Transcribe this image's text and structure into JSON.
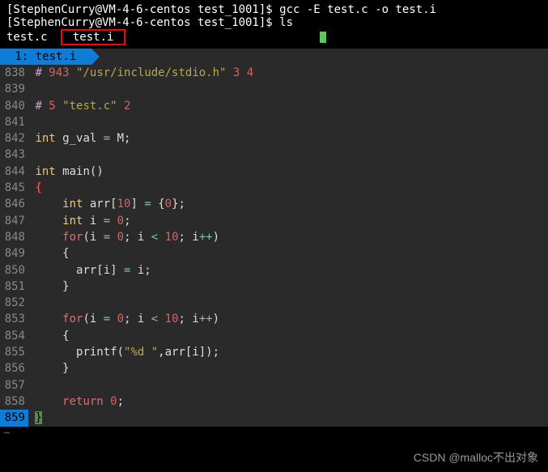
{
  "terminal": {
    "prompt1_full": "[StephenCurry@VM-4-6-centos test_1001]$ ",
    "cmd1": "gcc -E test.c -o test.i",
    "prompt2_full": "[StephenCurry@VM-4-6-centos test_1001]$ ",
    "cmd2": "ls",
    "ls_file1": "test.c  ",
    "ls_file2": " test.i "
  },
  "tab": {
    "label": " 1: test.i "
  },
  "code": {
    "lines": [
      {
        "num": "838",
        "tokens": [
          {
            "t": "# ",
            "c": "c-hash"
          },
          {
            "t": "943",
            "c": "c-number"
          },
          {
            "t": " ",
            "c": ""
          },
          {
            "t": "\"/usr/include/stdio.h\"",
            "c": "c-string"
          },
          {
            "t": " ",
            "c": ""
          },
          {
            "t": "3 4",
            "c": "c-number"
          }
        ]
      },
      {
        "num": "839",
        "tokens": []
      },
      {
        "num": "840",
        "tokens": [
          {
            "t": "# ",
            "c": "c-hash"
          },
          {
            "t": "5",
            "c": "c-number"
          },
          {
            "t": " ",
            "c": ""
          },
          {
            "t": "\"test.c\"",
            "c": "c-string"
          },
          {
            "t": " ",
            "c": ""
          },
          {
            "t": "2",
            "c": "c-number"
          }
        ]
      },
      {
        "num": "841",
        "tokens": []
      },
      {
        "num": "842",
        "tokens": [
          {
            "t": "int",
            "c": "c-type"
          },
          {
            "t": " g_val ",
            "c": "c-ident"
          },
          {
            "t": "=",
            "c": "c-op"
          },
          {
            "t": " M;",
            "c": "c-ident"
          }
        ]
      },
      {
        "num": "843",
        "tokens": []
      },
      {
        "num": "844",
        "tokens": [
          {
            "t": "int",
            "c": "c-type"
          },
          {
            "t": " ",
            "c": ""
          },
          {
            "t": "main",
            "c": "c-func"
          },
          {
            "t": "()",
            "c": "c-punct"
          }
        ]
      },
      {
        "num": "845",
        "tokens": [
          {
            "t": "{",
            "c": "c-brace-red"
          }
        ]
      },
      {
        "num": "846",
        "tokens": [
          {
            "t": "    ",
            "c": ""
          },
          {
            "t": "int",
            "c": "c-type"
          },
          {
            "t": " arr[",
            "c": "c-ident"
          },
          {
            "t": "10",
            "c": "c-number"
          },
          {
            "t": "] ",
            "c": "c-ident"
          },
          {
            "t": "=",
            "c": "c-op"
          },
          {
            "t": " {",
            "c": "c-punct"
          },
          {
            "t": "0",
            "c": "c-number"
          },
          {
            "t": "};",
            "c": "c-punct"
          }
        ]
      },
      {
        "num": "847",
        "tokens": [
          {
            "t": "    ",
            "c": ""
          },
          {
            "t": "int",
            "c": "c-type"
          },
          {
            "t": " i ",
            "c": "c-ident"
          },
          {
            "t": "=",
            "c": "c-op"
          },
          {
            "t": " ",
            "c": ""
          },
          {
            "t": "0",
            "c": "c-number"
          },
          {
            "t": ";",
            "c": "c-punct"
          }
        ]
      },
      {
        "num": "848",
        "tokens": [
          {
            "t": "    ",
            "c": ""
          },
          {
            "t": "for",
            "c": "c-keyword"
          },
          {
            "t": "(i ",
            "c": "c-ident"
          },
          {
            "t": "=",
            "c": "c-op"
          },
          {
            "t": " ",
            "c": ""
          },
          {
            "t": "0",
            "c": "c-number"
          },
          {
            "t": "; i ",
            "c": "c-ident"
          },
          {
            "t": "<",
            "c": "c-op"
          },
          {
            "t": " ",
            "c": ""
          },
          {
            "t": "10",
            "c": "c-number"
          },
          {
            "t": "; i",
            "c": "c-ident"
          },
          {
            "t": "++",
            "c": "c-op"
          },
          {
            "t": ")",
            "c": "c-punct"
          }
        ]
      },
      {
        "num": "849",
        "tokens": [
          {
            "t": "    {",
            "c": "c-punct"
          }
        ]
      },
      {
        "num": "850",
        "tokens": [
          {
            "t": "      arr[i] ",
            "c": "c-ident"
          },
          {
            "t": "=",
            "c": "c-op"
          },
          {
            "t": " i;",
            "c": "c-ident"
          }
        ]
      },
      {
        "num": "851",
        "tokens": [
          {
            "t": "    }",
            "c": "c-punct"
          }
        ]
      },
      {
        "num": "852",
        "tokens": []
      },
      {
        "num": "853",
        "tokens": [
          {
            "t": "    ",
            "c": ""
          },
          {
            "t": "for",
            "c": "c-keyword"
          },
          {
            "t": "(i ",
            "c": "c-ident"
          },
          {
            "t": "=",
            "c": "c-op"
          },
          {
            "t": " ",
            "c": ""
          },
          {
            "t": "0",
            "c": "c-number"
          },
          {
            "t": "; i ",
            "c": "c-ident"
          },
          {
            "t": "<",
            "c": "c-op"
          },
          {
            "t": " ",
            "c": ""
          },
          {
            "t": "10",
            "c": "c-number"
          },
          {
            "t": "; i",
            "c": "c-ident"
          },
          {
            "t": "++",
            "c": "c-op"
          },
          {
            "t": ")",
            "c": "c-punct"
          }
        ]
      },
      {
        "num": "854",
        "tokens": [
          {
            "t": "    {",
            "c": "c-punct"
          }
        ]
      },
      {
        "num": "855",
        "tokens": [
          {
            "t": "      printf(",
            "c": "c-ident"
          },
          {
            "t": "\"%d \"",
            "c": "c-string"
          },
          {
            "t": ",arr[i]);",
            "c": "c-ident"
          }
        ]
      },
      {
        "num": "856",
        "tokens": [
          {
            "t": "    }",
            "c": "c-punct"
          }
        ]
      },
      {
        "num": "857",
        "tokens": []
      },
      {
        "num": "858",
        "tokens": [
          {
            "t": "    ",
            "c": ""
          },
          {
            "t": "return",
            "c": "c-return"
          },
          {
            "t": " ",
            "c": ""
          },
          {
            "t": "0",
            "c": "c-number"
          },
          {
            "t": ";",
            "c": "c-punct"
          }
        ]
      },
      {
        "num": "859",
        "tokens": [
          {
            "t": "}",
            "c": "c-brace-green"
          }
        ],
        "hl": true
      }
    ]
  },
  "watermark": "CSDN @malloc不出对象"
}
